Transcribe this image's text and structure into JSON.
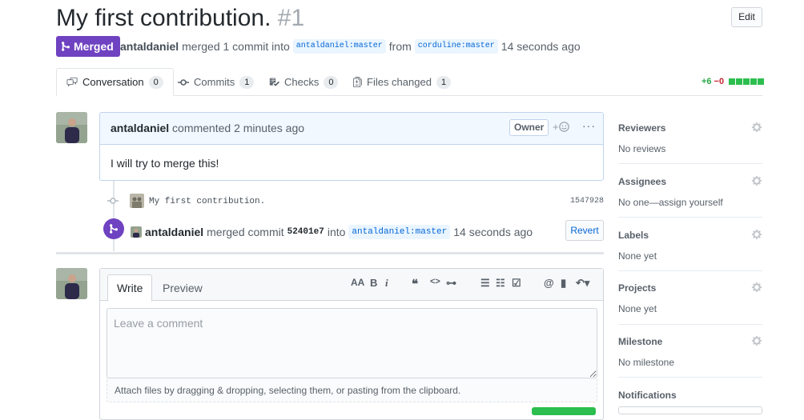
{
  "pr": {
    "title": "My first contribution.",
    "number": "#1",
    "edit_label": "Edit",
    "state": "Merged",
    "author": "antaldaniel",
    "merged_text": "merged 1 commit into",
    "base_branch": "antaldaniel:master",
    "from_text": "from",
    "head_branch": "corduline:master",
    "time_ago": "14 seconds ago"
  },
  "tabs": [
    {
      "label": "Conversation",
      "count": "0"
    },
    {
      "label": "Commits",
      "count": "1"
    },
    {
      "label": "Checks",
      "count": "0"
    },
    {
      "label": "Files changed",
      "count": "1"
    }
  ],
  "diffstat": {
    "additions": "+6",
    "deletions": "−0"
  },
  "comment": {
    "author": "antaldaniel",
    "action": "commented 2 minutes ago",
    "badge": "Owner",
    "react": "+",
    "menu": "···",
    "body": "I will try to merge this!"
  },
  "commit": {
    "message": "My first contribution.",
    "sha": "1547928"
  },
  "merge_event": {
    "author": "antaldaniel",
    "text1": "merged commit",
    "sha": "52401e7",
    "text2": "into",
    "branch": "antaldaniel:master",
    "time": "14 seconds ago",
    "revert_label": "Revert"
  },
  "new_comment": {
    "write_tab": "Write",
    "preview_tab": "Preview",
    "placeholder": "Leave a comment",
    "attach_hint": "Attach files by dragging & dropping, selecting them, or pasting from the clipboard.",
    "toolbar": {
      "heading": "AA",
      "bold": "B",
      "italic": "i",
      "quote": "❝",
      "code": "<>",
      "link": "⊶",
      "ul": "☰",
      "ol": "☷",
      "tasks": "☑",
      "mention": "@",
      "saved": "▮",
      "reply": "↶▾"
    }
  },
  "sidebar": [
    {
      "title": "Reviewers",
      "value": "No reviews"
    },
    {
      "title": "Assignees",
      "value": "No one—assign yourself"
    },
    {
      "title": "Labels",
      "value": "None yet"
    },
    {
      "title": "Projects",
      "value": "None yet"
    },
    {
      "title": "Milestone",
      "value": "No milestone"
    },
    {
      "title": "Notifications",
      "value": ""
    }
  ],
  "colors": {
    "merged": "#6f42c1",
    "link": "#0366d6",
    "add": "#28a745",
    "del": "#cb2431"
  }
}
